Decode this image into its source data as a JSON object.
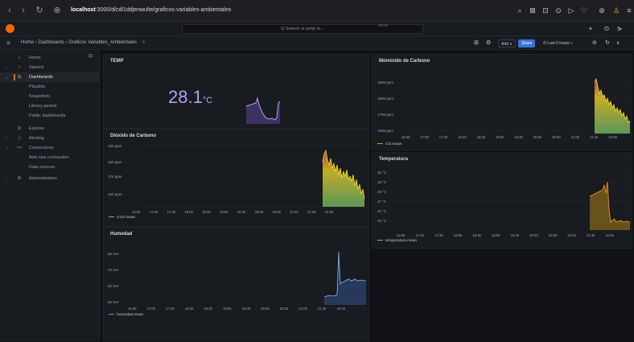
{
  "browser": {
    "url_host": "localhost",
    "url_rest": ":3000/d/cdl1ddjenwulte/graficos-variables-ambientales"
  },
  "topbar": {
    "search_placeholder": "Q Search or jump to...",
    "search_shortcut": "ctrl+k"
  },
  "breadcrumb": {
    "home": "Home",
    "dashboards": "Dashboards",
    "current": "Graficos Variables_Ambientales",
    "sep": "›"
  },
  "toolbar": {
    "add_label": "Add ∨",
    "share_label": "Share",
    "time_range": "⏱ Last 6 hours ∨"
  },
  "sidebar": {
    "items": [
      {
        "label": "Home"
      },
      {
        "label": "Starred"
      },
      {
        "label": "Dashboards"
      },
      {
        "label": "Playlists"
      },
      {
        "label": "Snapshots"
      },
      {
        "label": "Library panels"
      },
      {
        "label": "Public dashboards"
      },
      {
        "label": "Explore"
      },
      {
        "label": "Alerting"
      },
      {
        "label": "Connections"
      },
      {
        "label": "Add new connection"
      },
      {
        "label": "Data sources"
      },
      {
        "label": "Administration"
      }
    ]
  },
  "colors": {
    "accent": "#f46800",
    "share": "#3d71d9",
    "stat": "#b7a0f2",
    "green": "#73bf69",
    "yellow": "#fade2a",
    "red": "#f2495c",
    "blue": "#5794f2",
    "purple": "#8f6bd6"
  },
  "panels": {
    "temp": {
      "title": "TEMP",
      "value": "28.1",
      "unit": "°C"
    },
    "co2": {
      "title": "Dióxido de Carbono",
      "legend": "CO2.mean",
      "yticks": [
        "180 ppm",
        "160 ppm",
        "170 ppm",
        "160 ppm"
      ],
      "xticks": [
        "16:30",
        "17:00",
        "17:30",
        "18:00",
        "18:30",
        "19:00",
        "19:30",
        "20:00",
        "20:30",
        "21:00",
        "21:30",
        "22:00"
      ]
    },
    "monoxide": {
      "title": "Monóxido de Carbono",
      "legend": "CO.mean",
      "yticks": [
        "1900 ppm",
        "1800 ppm",
        "1700 ppm",
        "1600 ppm"
      ],
      "xticks": [
        "16:30",
        "17:00",
        "17:30",
        "18:00",
        "18:30",
        "19:00",
        "19:30",
        "20:00",
        "20:30",
        "21:00",
        "21:30",
        "22:00"
      ]
    },
    "temperatura": {
      "title": "Temperatura",
      "legend": "temperatura.mean",
      "yticks": [
        "30 °C",
        "29 °C",
        "28 °C",
        "27 °C",
        "26 °C",
        "25 °C"
      ],
      "xticks": [
        "16:30",
        "17:00",
        "17:30",
        "18:00",
        "18:30",
        "19:00",
        "19:30",
        "20:00",
        "20:30",
        "21:00",
        "21:30",
        "22:00"
      ]
    },
    "humedad": {
      "title": "Humedad",
      "legend": "humedad.mean",
      "yticks": [
        "80 %H",
        "70 %H",
        "60 %H",
        "50 %H"
      ],
      "xticks": [
        "16:30",
        "17:00",
        "17:30",
        "18:00",
        "18:30",
        "19:00",
        "19:30",
        "20:00",
        "20:30",
        "21:00",
        "21:30",
        "22:00"
      ]
    }
  }
}
